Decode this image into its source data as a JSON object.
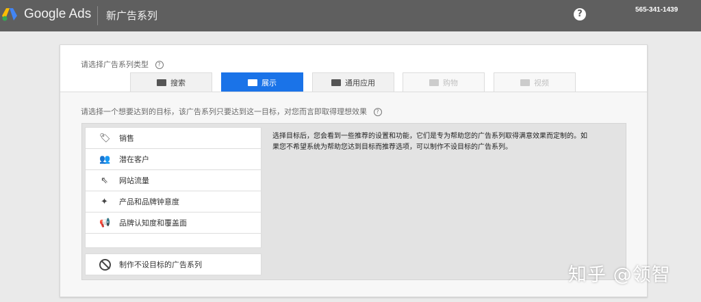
{
  "header": {
    "brand": "Google Ads",
    "breadcrumb": "新广告系列",
    "help_symbol": "?",
    "account_id": "565-341-1439"
  },
  "campaign_type": {
    "label": "请选择广告系列类型",
    "help_symbol": "?",
    "tabs": [
      {
        "label": "搜索",
        "icon": "search-icon",
        "state": "normal"
      },
      {
        "label": "展示",
        "icon": "display-icon",
        "state": "selected"
      },
      {
        "label": "通用应用",
        "icon": "app-icon",
        "state": "normal"
      },
      {
        "label": "购物",
        "icon": "shopping-tag-icon",
        "state": "disabled"
      },
      {
        "label": "视频",
        "icon": "video-icon",
        "state": "disabled"
      }
    ]
  },
  "goals": {
    "label": "请选择一个想要达到的目标，该广告系列只要达到这一目标，对您而言即取得理想效果",
    "help_symbol": "?",
    "items": [
      {
        "label": "销售",
        "icon": "tag-icon",
        "glyph": "🏷"
      },
      {
        "label": "潜在客户",
        "icon": "people-icon",
        "glyph": "👥"
      },
      {
        "label": "网站流量",
        "icon": "cursor-click-icon",
        "glyph": "⇖"
      },
      {
        "label": "产品和品牌钟意度",
        "icon": "sparkle-icon",
        "glyph": "✦"
      },
      {
        "label": "品牌认知度和覆盖面",
        "icon": "megaphone-icon",
        "glyph": "📢"
      }
    ],
    "no_goal_label": "制作不设目标的广告系列",
    "description": "选择目标后，您会看到一些推荐的设置和功能，它们是专为帮助您的广告系列取得满意效果而定制的。如果您不希望系统为帮助您达到目标而推荐选项，可以制作不设目标的广告系列。"
  },
  "watermark": "知乎 @领智",
  "colors": {
    "topbar": "#5f5f5f",
    "accent": "#1a73e8"
  }
}
